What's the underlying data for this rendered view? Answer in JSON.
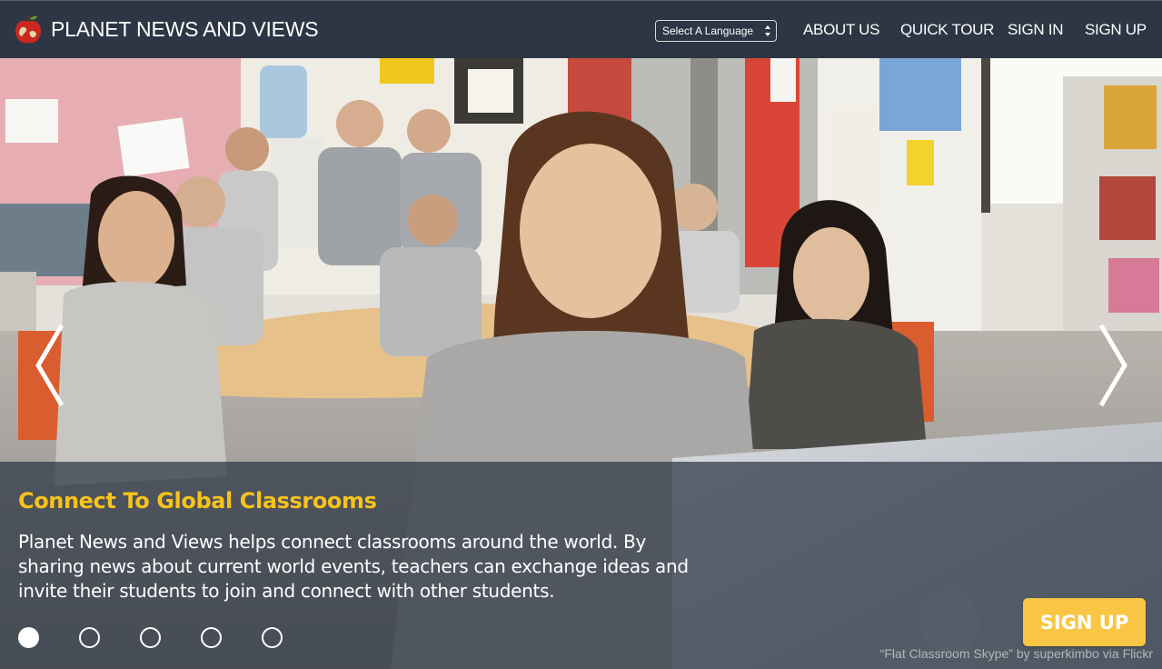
{
  "header": {
    "brand_title": "PLANET NEWS AND VIEWS",
    "logo_icon": "apple-globe-icon",
    "language_select": {
      "selected": "Select A Language"
    },
    "nav": [
      {
        "label": "ABOUT US"
      },
      {
        "label": "QUICK TOUR"
      },
      {
        "label": "SIGN IN"
      },
      {
        "label": "SIGN UP"
      }
    ]
  },
  "hero": {
    "heading": "Connect To Global Classrooms",
    "text": "Planet News and Views helps connect classrooms around the world. By sharing news about current world events, teachers can exchange ideas and invite their students to join and connect with other students.",
    "prev_arrow": "❬",
    "next_arrow": "❭",
    "slides": {
      "count": 5,
      "active_index": 0
    },
    "cta_label": "SIGN UP",
    "photo_credit": "“Flat Classroom Skype” by superkimbo via Flickr"
  },
  "colors": {
    "header_bg": "#2c3644",
    "accent_yellow": "#f7c21c",
    "cta_bg": "#f9c644",
    "logo_red": "#c8281e"
  }
}
